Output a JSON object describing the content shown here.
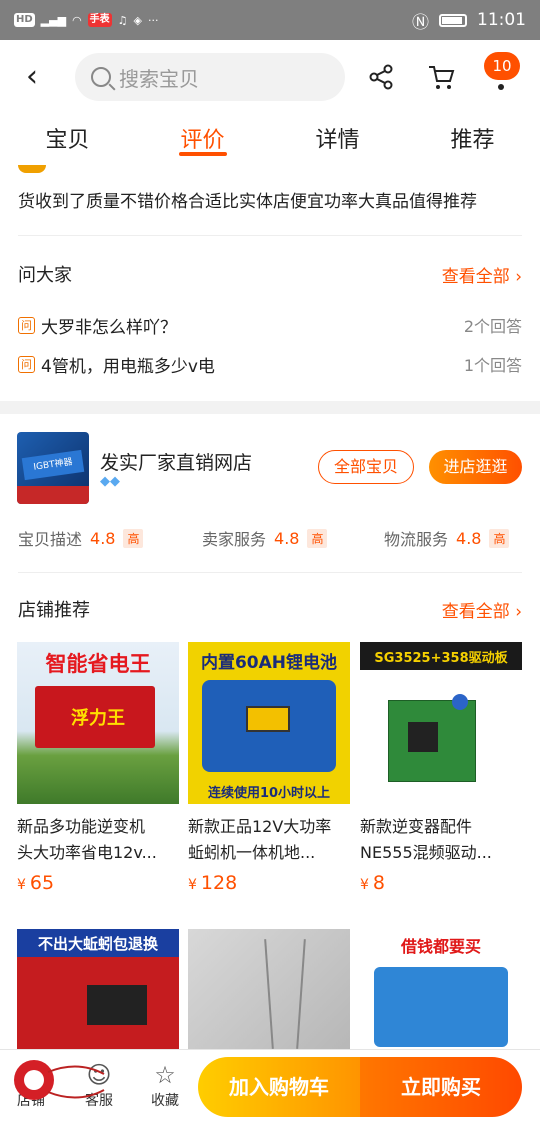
{
  "status": {
    "time": "11:01",
    "chips": [
      "HD",
      "46",
      "手表"
    ]
  },
  "header": {
    "search_placeholder": "搜索宝贝",
    "cart_badge": "10",
    "tabs": [
      {
        "label": "宝贝",
        "active": false
      },
      {
        "label": "评价",
        "active": true
      },
      {
        "label": "详情",
        "active": false
      },
      {
        "label": "推荐",
        "active": false
      }
    ]
  },
  "review": {
    "text": "货收到了质量不错价格合适比实体店便宜功率大真品值得推荐"
  },
  "qa": {
    "title": "问大家",
    "see_all": "查看全部",
    "items": [
      {
        "question": "大罗非怎么样吖？",
        "count": "2个回答"
      },
      {
        "question": "4管机，用电瓶多少v电",
        "count": "1个回答"
      }
    ]
  },
  "shop": {
    "name": "发实厂家直销网店",
    "logo_text": "IGBT神器",
    "all_items": "全部宝贝",
    "visit": "进店逛逛",
    "ratings": [
      {
        "label": "宝贝描述",
        "value": "4.8",
        "tag": "高"
      },
      {
        "label": "卖家服务",
        "value": "4.8",
        "tag": "高"
      },
      {
        "label": "物流服务",
        "value": "4.8",
        "tag": "高"
      }
    ]
  },
  "recommend": {
    "title": "店铺推荐",
    "see_all": "查看全部",
    "products": [
      {
        "title_line1": "新品多功能逆变机",
        "title_line2": "头大功率省电12v...",
        "price": "65",
        "img_text": "智能省电王",
        "img_sub": "浮力王"
      },
      {
        "title_line1": "新款正品12V大功率",
        "title_line2": "蚯蚓机一体机地...",
        "price": "128",
        "img_text": "内置60AH锂电池",
        "img_sub": "连续使用10小时以上"
      },
      {
        "title_line1": "新款逆变器配件",
        "title_line2": "NE555混频驱动...",
        "price": "8",
        "img_text": "SG3525+358驱动板",
        "img_sub": ""
      }
    ],
    "partial_products": [
      {
        "img_text": "不出大蚯蚓包退换"
      },
      {
        "img_text": ""
      },
      {
        "img_text": "借钱都要买"
      }
    ]
  },
  "bottom": {
    "shop": "店铺",
    "service": "客服",
    "favorite": "收藏",
    "add_cart": "加入购物车",
    "buy_now": "立即购买"
  },
  "currency": "¥"
}
